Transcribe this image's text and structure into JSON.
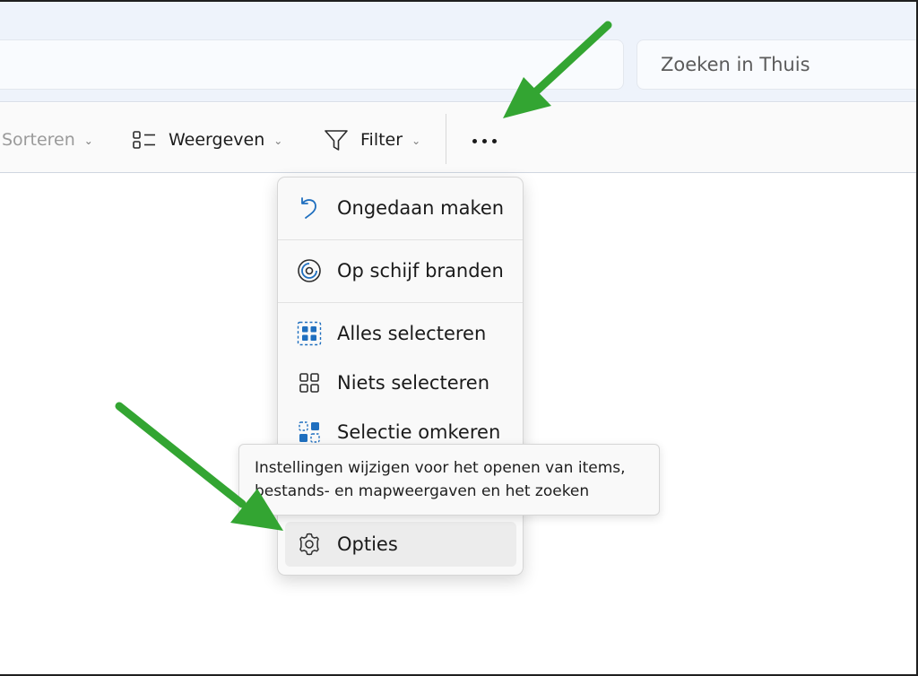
{
  "search": {
    "placeholder": "Zoeken in Thuis"
  },
  "toolbar": {
    "sort_label": "Sorteren",
    "view_label": "Weergeven",
    "filter_label": "Filter"
  },
  "menu": {
    "items": [
      {
        "label": "Ongedaan maken",
        "icon": "undo-icon"
      },
      {
        "label": "Op schijf branden",
        "icon": "burn-disc-icon"
      },
      {
        "label": "Alles selecteren",
        "icon": "select-all-icon"
      },
      {
        "label": "Niets selecteren",
        "icon": "select-none-icon"
      },
      {
        "label": "Selectie omkeren",
        "icon": "invert-selection-icon"
      },
      {
        "label": "Opties",
        "icon": "gear-icon"
      }
    ]
  },
  "tooltip": {
    "line1": "Instellingen wijzigen voor het openen van items,",
    "line2": "bestands- en mapweergaven en het zoeken"
  },
  "colors": {
    "accent": "#0067c0",
    "annotation_arrow": "#33a532"
  }
}
